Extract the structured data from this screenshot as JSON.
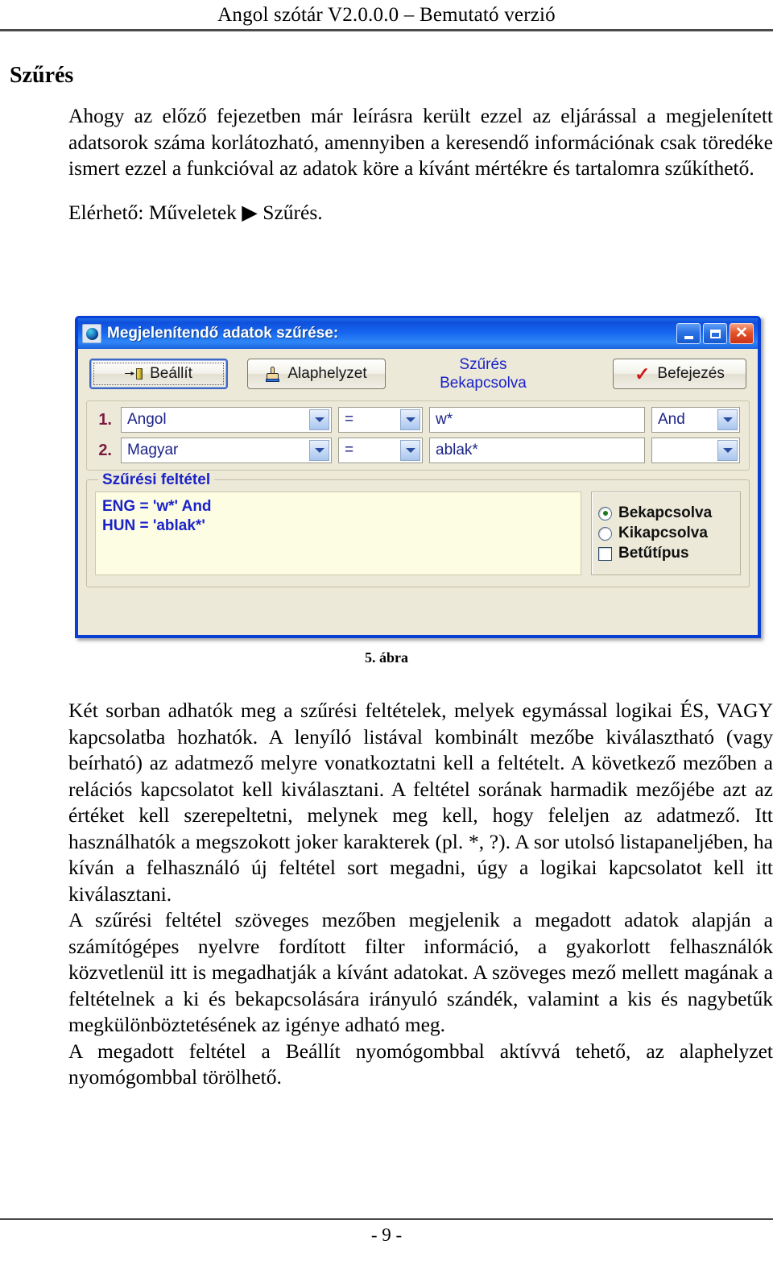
{
  "document": {
    "header": "Angol szótár V2.0.0.0 – Bemutató verzió",
    "section_title": "Szűrés",
    "paragraph_1": "Ahogy az előző fejezetben már leírásra került ezzel az eljárással a megjelenített adatsorok száma korlátozható, amennyiben a keresendő információnak csak töredéke ismert ezzel a funkcióval az adatok köre a kívánt mértékre és tartalomra szűkíthető.",
    "access_line_prefix": "Elérhető: Műveletek",
    "access_line_arrow": "▶",
    "access_line_suffix": "Szűrés.",
    "figure_caption": "5. ábra",
    "paragraph_2": "Két sorban adhatók meg a szűrési feltételek, melyek egymással logikai ÉS, VAGY kapcsolatba hozhatók. A lenyíló listával kombinált mezőbe kiválasztható (vagy beírható) az adatmező melyre vonatkoztatni kell a feltételt. A következő mezőben a relációs kapcsolatot kell kiválasztani. A feltétel sorának harmadik mezőjébe azt az értéket kell szerepeltetni, melynek meg kell, hogy feleljen az adatmező. Itt használhatók a megszokott joker karakterek (pl. *, ?). A sor utolsó listapaneljében, ha kíván a felhasználó új feltétel sort megadni, úgy a logikai kapcsolatot kell itt kiválasztani.",
    "paragraph_3": "A szűrési feltétel szöveges mezőben megjelenik a megadott adatok alapján a számítógépes nyelvre fordított filter információ, a gyakorlott felhasználók közvetlenül itt is megadhatják a kívánt adatokat. A szöveges mező mellett magának a feltételnek a ki és bekapcsolására irányuló szándék, valamint a kis és nagybetűk megkülönböztetésének az igénye adható meg.",
    "paragraph_4": "A megadott feltétel a Beállít nyomógombbal aktívvá tehető, az alaphelyzet nyomógombbal törölhető.",
    "footer": "- 9 -"
  },
  "dialog": {
    "title": "Megjelenítendő adatok szűrése:",
    "title_icon": "globe-icon",
    "window_controls": {
      "minimize": "minimize-icon",
      "maximize": "maximize-icon",
      "close": "close-icon"
    },
    "toolbar": {
      "apply_label": "Beállít",
      "apply_icon": "filter-apply-icon",
      "reset_label": "Alaphelyzet",
      "reset_icon": "hand-pointer-icon",
      "status_title": "Szűrés",
      "status_value": "Bekapcsolva",
      "finish_label": "Befejezés",
      "finish_icon": "red-check-icon"
    },
    "rows": [
      {
        "number": "1.",
        "field": "Angol",
        "relation": "=",
        "value": "w*",
        "logic": "And"
      },
      {
        "number": "2.",
        "field": "Magyar",
        "relation": "=",
        "value": "ablak*",
        "logic": ""
      }
    ],
    "group": {
      "title": "Szűrési feltétel",
      "condition_line_1": "ENG = 'w*' And",
      "condition_line_2": "HUN = 'ablak*'",
      "options": {
        "enabled_label": "Bekapcsolva",
        "disabled_label": "Kikapcsolva",
        "fontcase_label": "Betűtípus"
      }
    }
  },
  "colors": {
    "title_bar_blue": "#1666ef",
    "dialog_face": "#ece9d8",
    "accent_blue_text": "#1b23c8",
    "row_number_maroon": "#7c1a3d",
    "condition_area_yellow": "#fdfde4",
    "close_button_red": "#c8331a",
    "radio_dot_green": "#1c7a1c"
  }
}
